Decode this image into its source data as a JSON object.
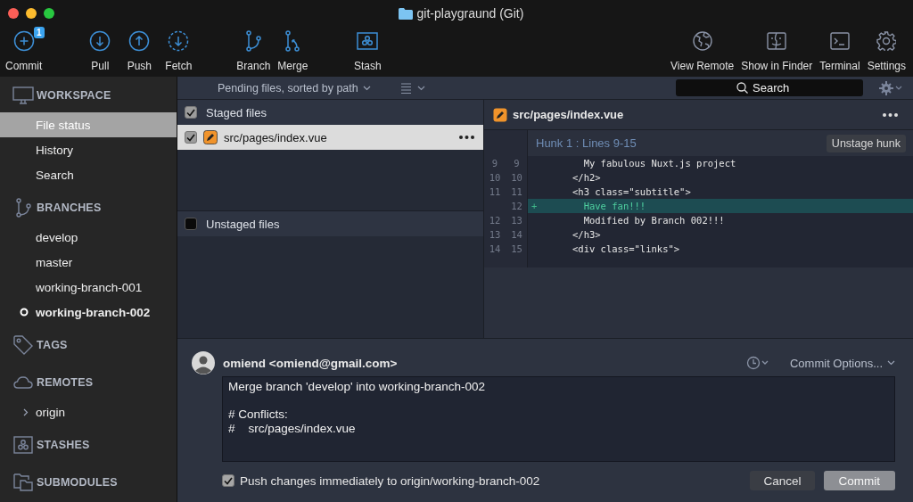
{
  "window": {
    "title": "git-playgraund (Git)"
  },
  "toolbar": {
    "groups": [
      [
        {
          "label": "Commit",
          "badge": "1"
        }
      ],
      [
        {
          "label": "Pull"
        },
        {
          "label": "Push"
        },
        {
          "label": "Fetch"
        }
      ],
      [
        {
          "label": "Branch"
        },
        {
          "label": "Merge"
        }
      ],
      [
        {
          "label": "Stash"
        }
      ]
    ],
    "right": [
      {
        "label": "View Remote"
      },
      {
        "label": "Show in Finder"
      },
      {
        "label": "Terminal"
      },
      {
        "label": "Settings"
      }
    ]
  },
  "sidebar": [
    {
      "title": "WORKSPACE",
      "items": [
        {
          "label": "File status",
          "selected": true,
          "current": false
        },
        {
          "label": "History",
          "selected": false,
          "current": false
        },
        {
          "label": "Search",
          "selected": false,
          "current": false
        }
      ]
    },
    {
      "title": "BRANCHES",
      "items": [
        {
          "label": "develop",
          "selected": false,
          "current": false
        },
        {
          "label": "master",
          "selected": false,
          "current": false
        },
        {
          "label": "working-branch-001",
          "selected": false,
          "current": false
        },
        {
          "label": "working-branch-002",
          "selected": false,
          "current": true
        }
      ]
    },
    {
      "title": "TAGS"
    },
    {
      "title": "REMOTES",
      "items": [
        {
          "label": "origin",
          "selected": false,
          "current": false,
          "expanded": false
        }
      ]
    },
    {
      "title": "STASHES"
    },
    {
      "title": "SUBMODULES"
    }
  ],
  "files_toolbar": {
    "sort": "Pending files, sorted by path",
    "search": {
      "placeholder": "Search"
    }
  },
  "staged": {
    "title": "Staged files",
    "checked": true,
    "files": [
      {
        "path": "src/pages/index.vue",
        "checked": true,
        "selected": true
      }
    ]
  },
  "unstaged": {
    "title": "Unstaged files",
    "checked": false
  },
  "diff": {
    "path": "src/pages/index.vue",
    "hunk": {
      "title": "Hunk 1 : Lines 9-15",
      "button": "Unstage hunk"
    },
    "lines": [
      {
        "old": "9",
        "new": "9",
        "kind": "context",
        "text": "  My fabulous Nuxt.js project"
      },
      {
        "old": "10",
        "new": "10",
        "kind": "context",
        "text": "</h2>"
      },
      {
        "old": "11",
        "new": "11",
        "kind": "context",
        "text": "<h3 class=\"subtitle\">"
      },
      {
        "new": "12",
        "kind": "added",
        "sign": "+",
        "text": "  Have fan!!!"
      },
      {
        "old": "12",
        "new": "13",
        "kind": "context",
        "text": "  Modified by Branch 002!!!"
      },
      {
        "old": "13",
        "new": "14",
        "kind": "context",
        "text": "</h3>"
      },
      {
        "old": "14",
        "new": "15",
        "kind": "context",
        "text": "<div class=\"links\">"
      }
    ]
  },
  "commit": {
    "author": "omiend <omiend@gmail.com>",
    "options": "Commit Options...",
    "message": "Merge branch 'develop' into working-branch-002\n\n# Conflicts:\n#\tsrc/pages/index.vue",
    "push": {
      "label": "Push changes immediately to origin/working-branch-002",
      "checked": true
    },
    "buttons": [
      "Cancel",
      "Commit"
    ]
  }
}
